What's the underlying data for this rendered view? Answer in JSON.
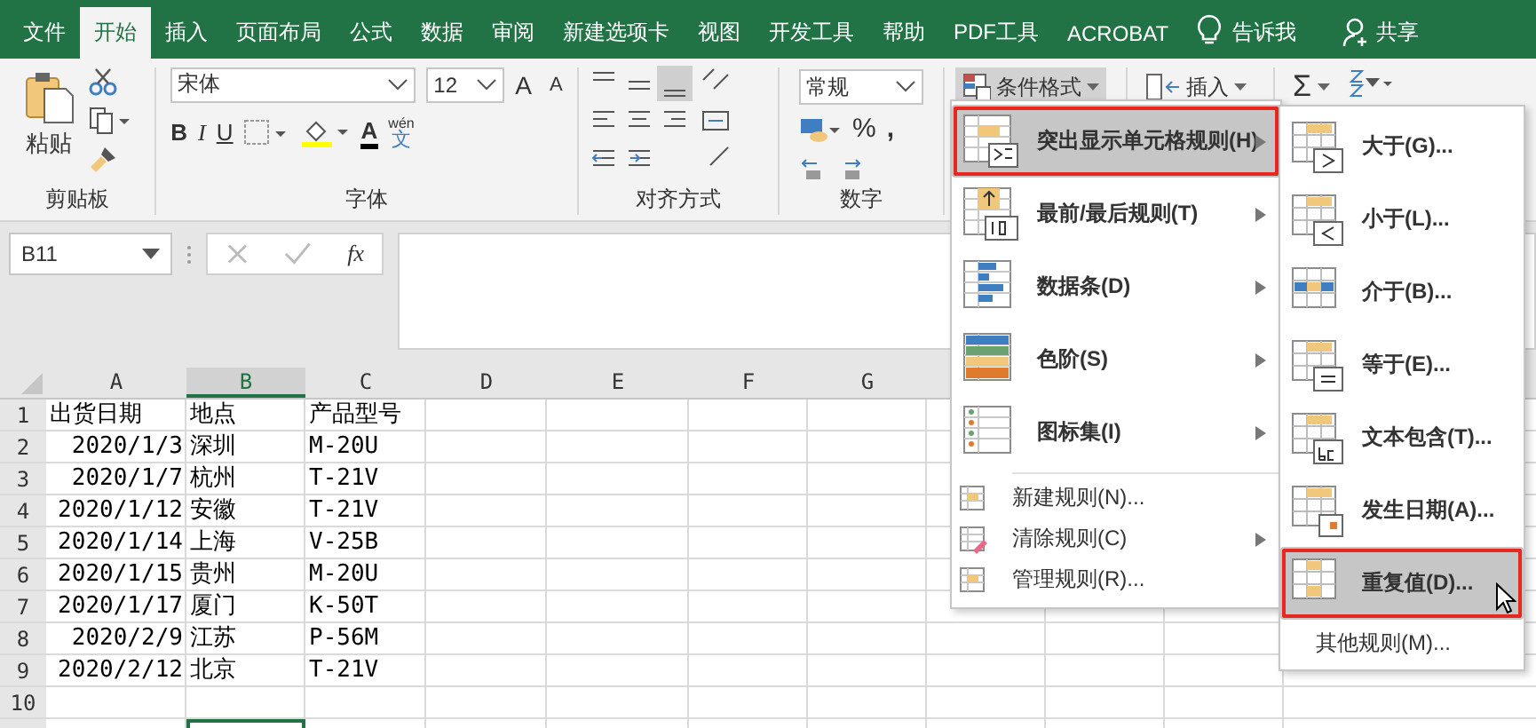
{
  "tabs": [
    {
      "label": "文件",
      "selected": false
    },
    {
      "label": "开始",
      "selected": true
    },
    {
      "label": "插入",
      "selected": false
    },
    {
      "label": "页面布局",
      "selected": false
    },
    {
      "label": "公式",
      "selected": false
    },
    {
      "label": "数据",
      "selected": false
    },
    {
      "label": "审阅",
      "selected": false
    },
    {
      "label": "新建选项卡",
      "selected": false
    },
    {
      "label": "视图",
      "selected": false
    },
    {
      "label": "开发工具",
      "selected": false
    },
    {
      "label": "帮助",
      "selected": false
    },
    {
      "label": "PDF工具",
      "selected": false
    },
    {
      "label": "ACROBAT",
      "selected": false
    }
  ],
  "tell_me": "告诉我",
  "share": "共享",
  "ribbon": {
    "clipboard": {
      "paste": "粘贴",
      "group": "剪贴板"
    },
    "font": {
      "name": "宋体",
      "size": "12",
      "grow": "A",
      "shrink": "A",
      "bold": "B",
      "italic": "I",
      "underline": "U",
      "font_color": "A",
      "phonetic": "wén",
      "phonetic_char": "文",
      "group": "字体"
    },
    "alignment": {
      "group": "对齐方式"
    },
    "number": {
      "format": "常规",
      "percent": "%",
      "comma": ",",
      "group": "数字"
    },
    "conditional_format": {
      "label": "条件格式",
      "pressed": true
    },
    "insert": "插入",
    "sum": "Σ"
  },
  "formula_bar": {
    "name_box": "B11",
    "fx": "fx"
  },
  "sheet": {
    "columns": [
      {
        "label": "A",
        "selected": false
      },
      {
        "label": "B",
        "selected": true
      },
      {
        "label": "C",
        "selected": false
      },
      {
        "label": "D",
        "selected": false
      },
      {
        "label": "E",
        "selected": false
      },
      {
        "label": "F",
        "selected": false
      },
      {
        "label": "G",
        "selected": false
      }
    ],
    "rows": [
      {
        "number": "1",
        "cells": [
          {
            "text": "出货日期",
            "kind": "text",
            "selected": false
          },
          {
            "text": "地点",
            "kind": "text",
            "selected": false
          },
          {
            "text": "产品型号",
            "kind": "text",
            "selected": false
          }
        ]
      },
      {
        "number": "2",
        "cells": [
          {
            "text": "2020/1/3",
            "kind": "date",
            "selected": false
          },
          {
            "text": "深圳",
            "kind": "text",
            "selected": false
          },
          {
            "text": "M-20U",
            "kind": "text",
            "selected": false
          }
        ]
      },
      {
        "number": "3",
        "cells": [
          {
            "text": "2020/1/7",
            "kind": "date",
            "selected": false
          },
          {
            "text": "杭州",
            "kind": "text",
            "selected": false
          },
          {
            "text": "T-21V",
            "kind": "text",
            "selected": false
          }
        ]
      },
      {
        "number": "4",
        "cells": [
          {
            "text": "2020/1/12",
            "kind": "date",
            "selected": false
          },
          {
            "text": "安徽",
            "kind": "text",
            "selected": false
          },
          {
            "text": "T-21V",
            "kind": "text",
            "selected": false
          }
        ]
      },
      {
        "number": "5",
        "cells": [
          {
            "text": "2020/1/14",
            "kind": "date",
            "selected": false
          },
          {
            "text": "上海",
            "kind": "text",
            "selected": false
          },
          {
            "text": "V-25B",
            "kind": "text",
            "selected": false
          }
        ]
      },
      {
        "number": "6",
        "cells": [
          {
            "text": "2020/1/15",
            "kind": "date",
            "selected": false
          },
          {
            "text": "贵州",
            "kind": "text",
            "selected": false
          },
          {
            "text": "M-20U",
            "kind": "text",
            "selected": false
          }
        ]
      },
      {
        "number": "7",
        "cells": [
          {
            "text": "2020/1/17",
            "kind": "date",
            "selected": false
          },
          {
            "text": "厦门",
            "kind": "text",
            "selected": false
          },
          {
            "text": "K-50T",
            "kind": "text",
            "selected": false
          }
        ]
      },
      {
        "number": "8",
        "cells": [
          {
            "text": "2020/2/9",
            "kind": "date",
            "selected": false
          },
          {
            "text": "江苏",
            "kind": "text",
            "selected": false
          },
          {
            "text": "P-56M",
            "kind": "text",
            "selected": false
          }
        ]
      },
      {
        "number": "9",
        "cells": [
          {
            "text": "2020/2/12",
            "kind": "date",
            "selected": false
          },
          {
            "text": "北京",
            "kind": "text",
            "selected": false
          },
          {
            "text": "T-21V",
            "kind": "text",
            "selected": false
          }
        ]
      },
      {
        "number": "10",
        "cells": [
          {
            "kind": "text",
            "selected": false
          },
          {
            "kind": "text",
            "selected": false
          },
          {
            "kind": "text",
            "selected": false
          }
        ]
      },
      {
        "cells": [
          {
            "kind": "text",
            "selected": false
          },
          {
            "kind": "text",
            "selected": true
          },
          {
            "kind": "text",
            "selected": false
          }
        ]
      }
    ]
  },
  "menu": {
    "items": [
      {
        "label": "突出显示单元格规则(H)",
        "kind": "large",
        "submenu": true,
        "selected": true,
        "outlined": true
      },
      {
        "label": "最前/最后规则(T)",
        "kind": "large",
        "submenu": true,
        "selected": false,
        "outlined": false
      },
      {
        "label": "数据条(D)",
        "kind": "large",
        "submenu": true,
        "selected": false,
        "outlined": false
      },
      {
        "label": "色阶(S)",
        "kind": "large",
        "submenu": true,
        "selected": false,
        "outlined": false
      },
      {
        "label": "图标集(I)",
        "kind": "large",
        "submenu": true,
        "selected": false,
        "outlined": false
      },
      {
        "label": "新建规则(N)...",
        "kind": "small",
        "submenu": false,
        "selected": false,
        "outlined": false
      },
      {
        "label": "清除规则(C)",
        "kind": "small",
        "submenu": true,
        "selected": false,
        "outlined": false
      },
      {
        "label": "管理规则(R)...",
        "kind": "small",
        "submenu": false,
        "selected": false,
        "outlined": false
      }
    ]
  },
  "submenu": {
    "items": [
      {
        "label": "大于(G)...",
        "kind": "large",
        "selected": false,
        "outlined": false
      },
      {
        "label": "小于(L)...",
        "kind": "large",
        "selected": false,
        "outlined": false
      },
      {
        "label": "介于(B)...",
        "kind": "large",
        "selected": false,
        "outlined": false
      },
      {
        "label": "等于(E)...",
        "kind": "large",
        "selected": false,
        "outlined": false
      },
      {
        "label": "文本包含(T)...",
        "kind": "large",
        "selected": false,
        "outlined": false
      },
      {
        "label": "发生日期(A)...",
        "kind": "large",
        "selected": false,
        "outlined": false
      },
      {
        "label": "重复值(D)...",
        "kind": "large",
        "selected": true,
        "outlined": true
      },
      {
        "label": "其他规则(M)...",
        "kind": "small",
        "selected": false,
        "outlined": false
      }
    ]
  }
}
